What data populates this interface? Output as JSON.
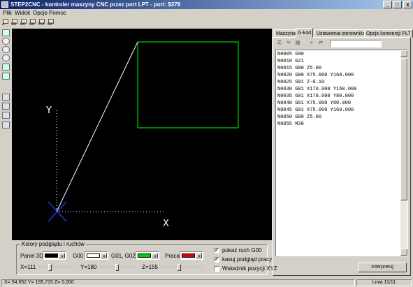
{
  "window": {
    "title": "STEP2CNC - kontroler maszyny CNC przez port LPT  - port: $378",
    "minimize": "_",
    "maximize": "□",
    "close": "x"
  },
  "menu": [
    "Plik",
    "Widok",
    "Opcje",
    "Pomoc"
  ],
  "toolbar": {
    "buttons": [
      {
        "icon": "open-file-icon",
        "label": "A"
      },
      {
        "icon": "gcode-file-icon",
        "label": "GC"
      },
      {
        "icon": "gcode-file-icon",
        "label": "GC"
      },
      {
        "icon": "gcode-file-icon",
        "label": "GC"
      },
      {
        "icon": "plt-file-icon",
        "label": "PLT"
      },
      {
        "icon": "save-file-icon",
        "label": "GC"
      }
    ]
  },
  "viewer": {
    "axis_x_label": "X",
    "axis_y_label": "Y",
    "rapid_color": "#ffffff",
    "work_color": "#00ff00",
    "axis_color": "#ffffff",
    "origin_color": "#1c2ea8"
  },
  "colors_panel": {
    "title": "Kolory podglądu i ruchów",
    "panel3d_label": "Panel 3D",
    "panel3d_color": "#000000",
    "g00_label": "G00",
    "g00_color": "#ffffff",
    "g01_label": "G01, G02...",
    "g01_color": "#00cc00",
    "praca_label": "Praca",
    "praca_color": "#dd0000",
    "x_label": "X=111",
    "y_label": "Y=180",
    "z_label": "Z=155",
    "x_value": 111,
    "y_value": 180,
    "z_value": 155,
    "slider_max": 360,
    "show_g00_label": "pokaż ruch G00",
    "show_g00_checked": true,
    "clear_label": "kasuj podgląd pracy",
    "clear_checked": true,
    "xyz_label": "Wskaźnik pozycji XYZ",
    "xyz_checked": false
  },
  "tabs": [
    "Maszyna",
    "G-kod",
    "Ustawienia sterownika",
    "Opcje konwersji PLT"
  ],
  "active_tab": 1,
  "gcode": [
    "N0005 G90",
    "N0010 G21",
    "N0015 G00 Z5.00",
    "N0020 G00 X75.000 Y160.000",
    "N0025 G01 Z-0.10",
    "N0030 G01 X170.000 Y160.000",
    "N0035 G01 X170.000 Y80.000",
    "N0040 G01 X75.000 Y80.000",
    "N0045 G01 X75.000 Y160.000",
    "N0050 G00 Z5.00",
    "N0055 M30"
  ],
  "interpret_button": "Interpretuj",
  "status": {
    "coords": "X= 54,952  Y= 165,715  Z= 0,000",
    "line": "Linia 11/11"
  }
}
